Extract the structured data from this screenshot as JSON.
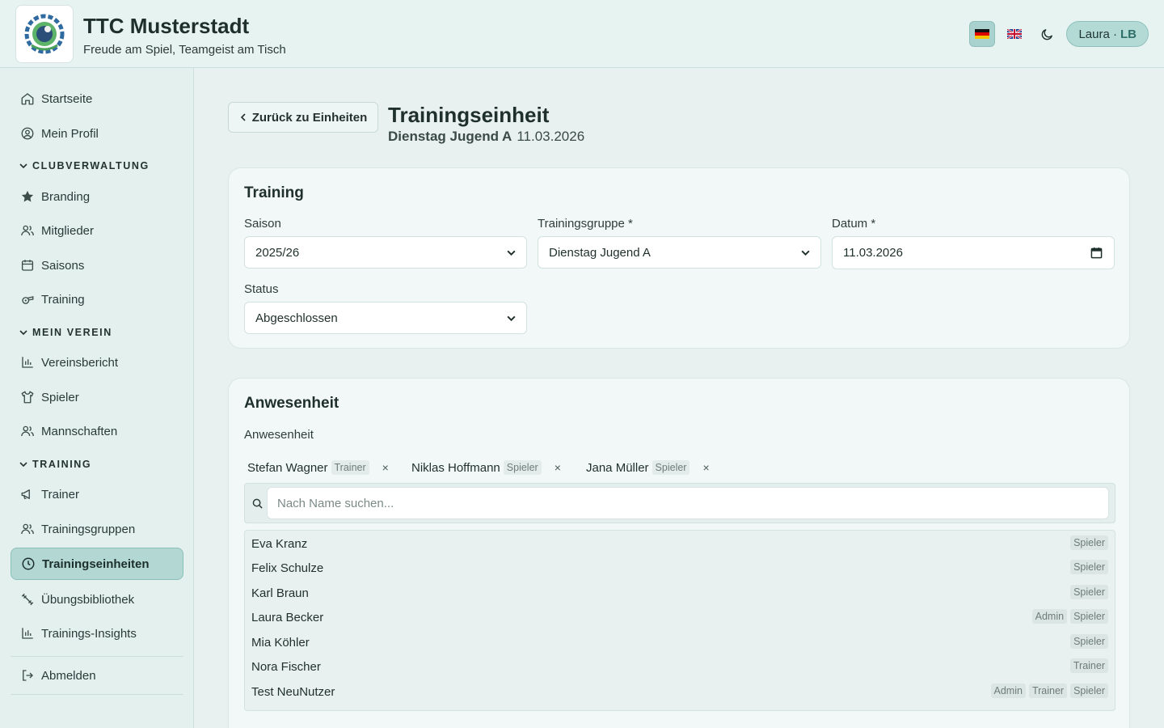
{
  "header": {
    "title": "TTC Musterstadt",
    "subtitle": "Freude am Spiel, Teamgeist am Tisch",
    "user_name": "Laura ·",
    "user_initials": "LB"
  },
  "sidebar": {
    "top_items": [
      {
        "label": "Startseite",
        "icon": "home-icon"
      },
      {
        "label": "Mein Profil",
        "icon": "user-circle-icon"
      }
    ],
    "sections": [
      {
        "title": "CLUBVERWALTUNG",
        "items": [
          {
            "label": "Branding",
            "icon": "star-icon"
          },
          {
            "label": "Mitglieder",
            "icon": "users-icon"
          },
          {
            "label": "Saisons",
            "icon": "calendar-icon"
          },
          {
            "label": "Training",
            "icon": "whistle-icon"
          }
        ]
      },
      {
        "title": "MEIN VEREIN",
        "items": [
          {
            "label": "Vereinsbericht",
            "icon": "bar-chart-icon"
          },
          {
            "label": "Spieler",
            "icon": "shirt-icon"
          },
          {
            "label": "Mannschaften",
            "icon": "users-icon"
          }
        ]
      },
      {
        "title": "TRAINING",
        "items": [
          {
            "label": "Trainer",
            "icon": "megaphone-icon"
          },
          {
            "label": "Trainingsgruppen",
            "icon": "users-icon"
          },
          {
            "label": "Trainingseinheiten",
            "icon": "clock-icon",
            "active": true
          },
          {
            "label": "Übungsbibliothek",
            "icon": "dumbbell-icon"
          },
          {
            "label": "Trainings-Insights",
            "icon": "bar-chart-icon"
          }
        ]
      }
    ],
    "logout_label": "Abmelden"
  },
  "page": {
    "back_label": "Zurück zu Einheiten",
    "title": "Trainingseinheit",
    "group": "Dienstag Jugend A",
    "date": "11.03.2026"
  },
  "training_card": {
    "title": "Training",
    "season_label": "Saison",
    "season_value": "2025/26",
    "group_label": "Trainingsgruppe *",
    "group_value": "Dienstag Jugend A",
    "date_label": "Datum *",
    "date_value": "11.03.2026",
    "status_label": "Status",
    "status_value": "Abgeschlossen"
  },
  "attendance_card": {
    "title": "Anwesenheit",
    "label": "Anwesenheit",
    "selected": [
      {
        "name": "Stefan Wagner",
        "role": "Trainer"
      },
      {
        "name": "Niklas Hoffmann",
        "role": "Spieler"
      },
      {
        "name": "Jana Müller",
        "role": "Spieler"
      }
    ],
    "remove_symbol": "×",
    "search_placeholder": "Nach Name suchen...",
    "options": [
      {
        "name": "Eva Kranz",
        "tags": [
          "Spieler"
        ]
      },
      {
        "name": "Felix Schulze",
        "tags": [
          "Spieler"
        ]
      },
      {
        "name": "Karl Braun",
        "tags": [
          "Spieler"
        ]
      },
      {
        "name": "Laura Becker",
        "tags": [
          "Admin",
          "Spieler"
        ]
      },
      {
        "name": "Mia Köhler",
        "tags": [
          "Spieler"
        ]
      },
      {
        "name": "Nora Fischer",
        "tags": [
          "Trainer"
        ]
      },
      {
        "name": "Test NeuNutzer",
        "tags": [
          "Admin",
          "Trainer",
          "Spieler"
        ]
      }
    ]
  },
  "colors": {
    "accent": "#b3d8d4",
    "background": "#e8f1ef",
    "card": "#f1f8f7"
  }
}
